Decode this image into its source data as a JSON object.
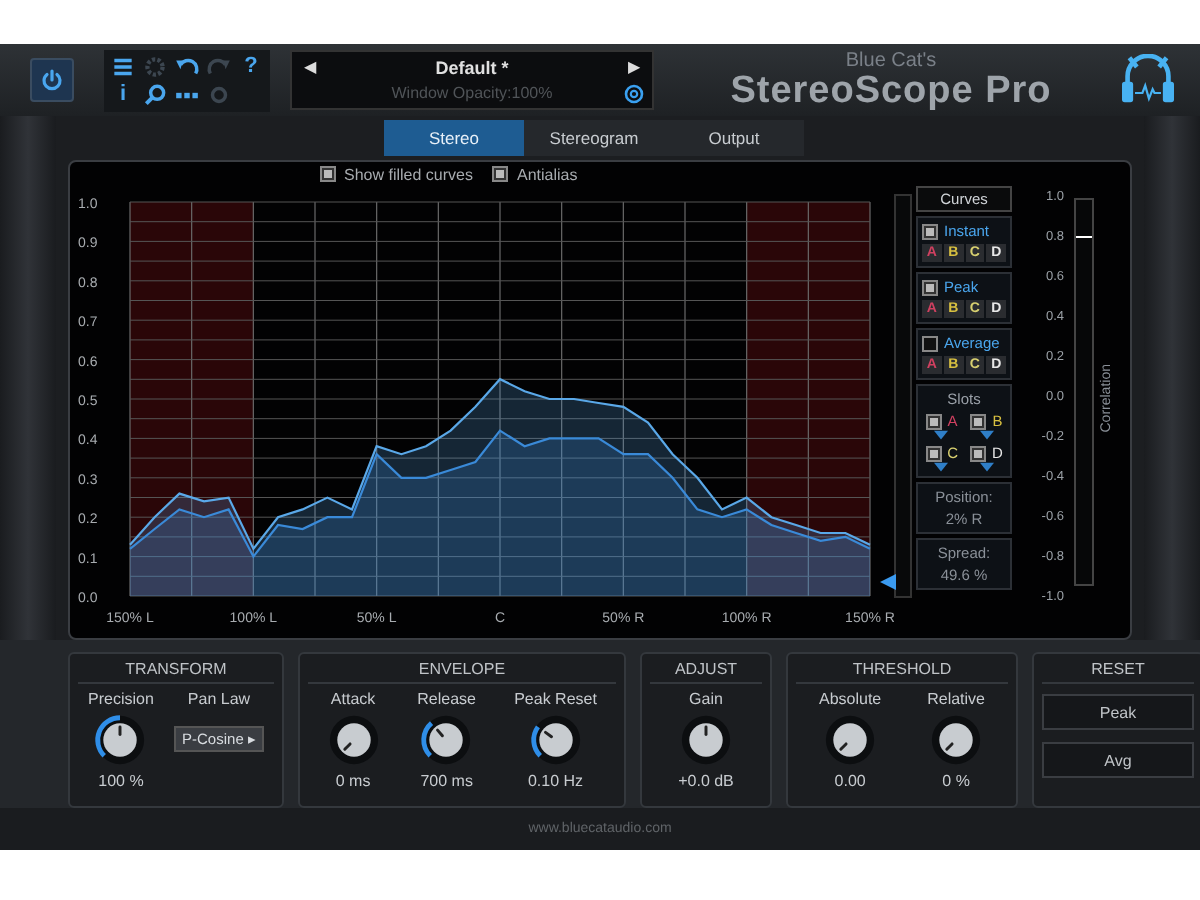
{
  "toolbar": {
    "info": "i",
    "help": "?"
  },
  "preset": {
    "prev": "◀",
    "name": "Default *",
    "next": "▶",
    "status": "Window Opacity:100%"
  },
  "brand": {
    "maker": "Blue Cat's",
    "product": "StereoScope Pro"
  },
  "tabs": [
    {
      "label": "Stereo",
      "selected": true
    },
    {
      "label": "Stereogram",
      "selected": false
    },
    {
      "label": "Output",
      "selected": false
    }
  ],
  "options": [
    {
      "label": "Show filled curves",
      "checked": true
    },
    {
      "label": "Antialias",
      "checked": true
    }
  ],
  "chart_data": {
    "type": "area",
    "x": [
      -150,
      -140,
      -130,
      -120,
      -110,
      -100,
      -90,
      -80,
      -70,
      -60,
      -50,
      -40,
      -30,
      -20,
      -10,
      0,
      10,
      20,
      30,
      40,
      50,
      60,
      70,
      80,
      90,
      100,
      110,
      120,
      130,
      140,
      150
    ],
    "series": [
      {
        "color": "#5aa8e8",
        "values": [
          0.13,
          0.2,
          0.26,
          0.24,
          0.25,
          0.12,
          0.2,
          0.22,
          0.25,
          0.22,
          0.38,
          0.36,
          0.38,
          0.42,
          0.48,
          0.55,
          0.52,
          0.5,
          0.5,
          0.49,
          0.48,
          0.44,
          0.36,
          0.3,
          0.22,
          0.25,
          0.2,
          0.18,
          0.16,
          0.16,
          0.13
        ]
      },
      {
        "color": "#3a8ad8",
        "values": [
          0.12,
          0.17,
          0.22,
          0.2,
          0.22,
          0.1,
          0.18,
          0.17,
          0.2,
          0.2,
          0.36,
          0.3,
          0.3,
          0.32,
          0.34,
          0.42,
          0.38,
          0.4,
          0.4,
          0.4,
          0.36,
          0.36,
          0.3,
          0.22,
          0.2,
          0.22,
          0.18,
          0.16,
          0.14,
          0.15,
          0.12
        ]
      }
    ],
    "xlim": [
      -150,
      150
    ],
    "ylim": [
      0,
      1
    ],
    "grid": true,
    "xticks": [
      {
        "value": -150,
        "label": "150% L"
      },
      {
        "value": -100,
        "label": "100% L"
      },
      {
        "value": -50,
        "label": "50% L"
      },
      {
        "value": 0,
        "label": "C"
      },
      {
        "value": 50,
        "label": "50% R"
      },
      {
        "value": 100,
        "label": "100% R"
      },
      {
        "value": 150,
        "label": "150% R"
      }
    ],
    "yticks": [
      {
        "value": 0,
        "label": "0.0"
      },
      {
        "value": 0.1,
        "label": "0.1"
      },
      {
        "value": 0.2,
        "label": "0.2"
      },
      {
        "value": 0.3,
        "label": "0.3"
      },
      {
        "value": 0.4,
        "label": "0.4"
      },
      {
        "value": 0.5,
        "label": "0.5"
      },
      {
        "value": 0.6,
        "label": "0.6"
      },
      {
        "value": 0.7,
        "label": "0.7"
      },
      {
        "value": 0.8,
        "label": "0.8"
      },
      {
        "value": 0.9,
        "label": "0.9"
      },
      {
        "value": 1,
        "label": "1.0"
      }
    ]
  },
  "curves": {
    "title": "Curves",
    "items": [
      {
        "label": "Instant",
        "checked": true,
        "slots": [
          {
            "label": "A",
            "color": "#d04060"
          },
          {
            "label": "B",
            "color": "#d8c040"
          },
          {
            "label": "C",
            "color": "#d8d070"
          },
          {
            "label": "D",
            "color": "#e8e8e8"
          }
        ]
      },
      {
        "label": "Peak",
        "checked": true,
        "slots": [
          {
            "label": "A",
            "color": "#d04060"
          },
          {
            "label": "B",
            "color": "#d8c040"
          },
          {
            "label": "C",
            "color": "#d8d070"
          },
          {
            "label": "D",
            "color": "#e8e8e8"
          }
        ]
      },
      {
        "label": "Average",
        "checked": false,
        "slots": [
          {
            "label": "A",
            "color": "#d04060"
          },
          {
            "label": "B",
            "color": "#d8c040"
          },
          {
            "label": "C",
            "color": "#d8d070"
          },
          {
            "label": "D",
            "color": "#e8e8e8"
          }
        ]
      }
    ]
  },
  "slots": {
    "title": "Slots",
    "items": [
      {
        "label": "A",
        "checked": true,
        "color": "#d04060"
      },
      {
        "label": "B",
        "checked": true,
        "color": "#d8c040"
      },
      {
        "label": "C",
        "checked": true,
        "color": "#d8d070"
      },
      {
        "label": "D",
        "checked": true,
        "color": "#e8e8e8"
      }
    ]
  },
  "position": {
    "label": "Position:",
    "value": "2% R"
  },
  "spread": {
    "label": "Spread:",
    "value": "49.6 %"
  },
  "correlation": {
    "label": "Correlation",
    "ticks": [
      "1.0",
      "0.8",
      "0.6",
      "0.4",
      "0.2",
      "0.0",
      "-0.2",
      "-0.4",
      "-0.6",
      "-0.8",
      "-1.0"
    ],
    "level": 0.9
  },
  "sections": [
    {
      "title": "TRANSFORM",
      "controls": [
        {
          "kind": "knob",
          "label": "Precision",
          "value": "100 %"
        },
        {
          "kind": "dropdown",
          "label": "Pan Law",
          "value": "P-Cosine ▸"
        }
      ]
    },
    {
      "title": "ENVELOPE",
      "controls": [
        {
          "kind": "knob",
          "label": "Attack",
          "value": "0 ms"
        },
        {
          "kind": "knob",
          "label": "Release",
          "value": "700 ms"
        },
        {
          "kind": "knob",
          "label": "Peak Reset",
          "value": "0.10 Hz"
        }
      ]
    },
    {
      "title": "ADJUST",
      "controls": [
        {
          "kind": "knob",
          "label": "Gain",
          "value": "+0.0 dB"
        }
      ]
    },
    {
      "title": "THRESHOLD",
      "controls": [
        {
          "kind": "knob",
          "label": "Absolute",
          "value": "0.00"
        },
        {
          "kind": "knob",
          "label": "Relative",
          "value": "0 %"
        }
      ]
    },
    {
      "title": "RESET",
      "controls": [
        {
          "kind": "button",
          "label": "Peak"
        },
        {
          "kind": "button",
          "label": "Avg"
        }
      ]
    }
  ],
  "footer": "www.bluecataudio.com"
}
